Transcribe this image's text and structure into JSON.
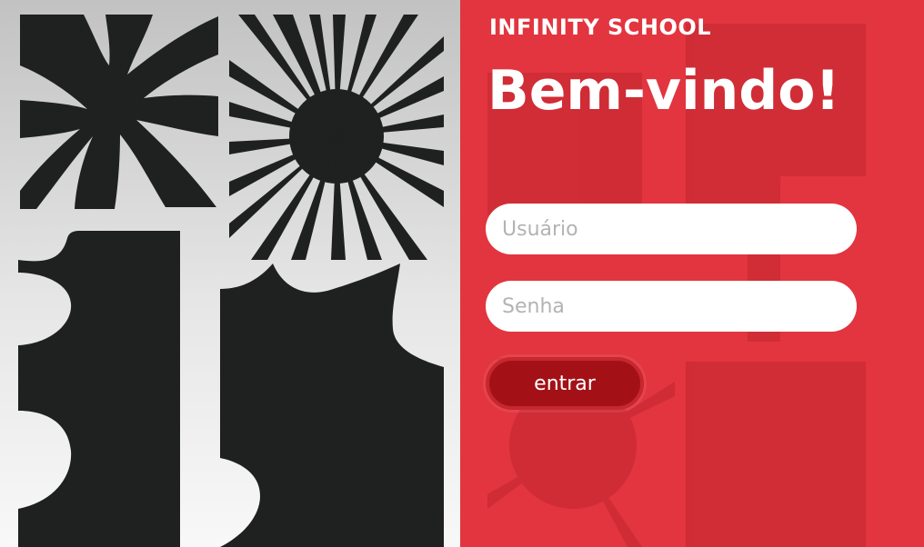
{
  "brand": {
    "name": "INFINITY SCHOOL"
  },
  "hero": {
    "title": "Bem-vindo!"
  },
  "form": {
    "username_placeholder": "Usuário",
    "password_placeholder": "Senha",
    "submit_label": "entrar"
  },
  "colors": {
    "panel": "#e2353f",
    "button": "#a31117",
    "shapes": "#1f2020"
  },
  "decor": {
    "left_panel": [
      "flower-shape",
      "sunburst-shape",
      "blob-column-shape",
      "splat-shape"
    ],
    "right_panel": [
      "faded-shapes-pattern"
    ]
  }
}
